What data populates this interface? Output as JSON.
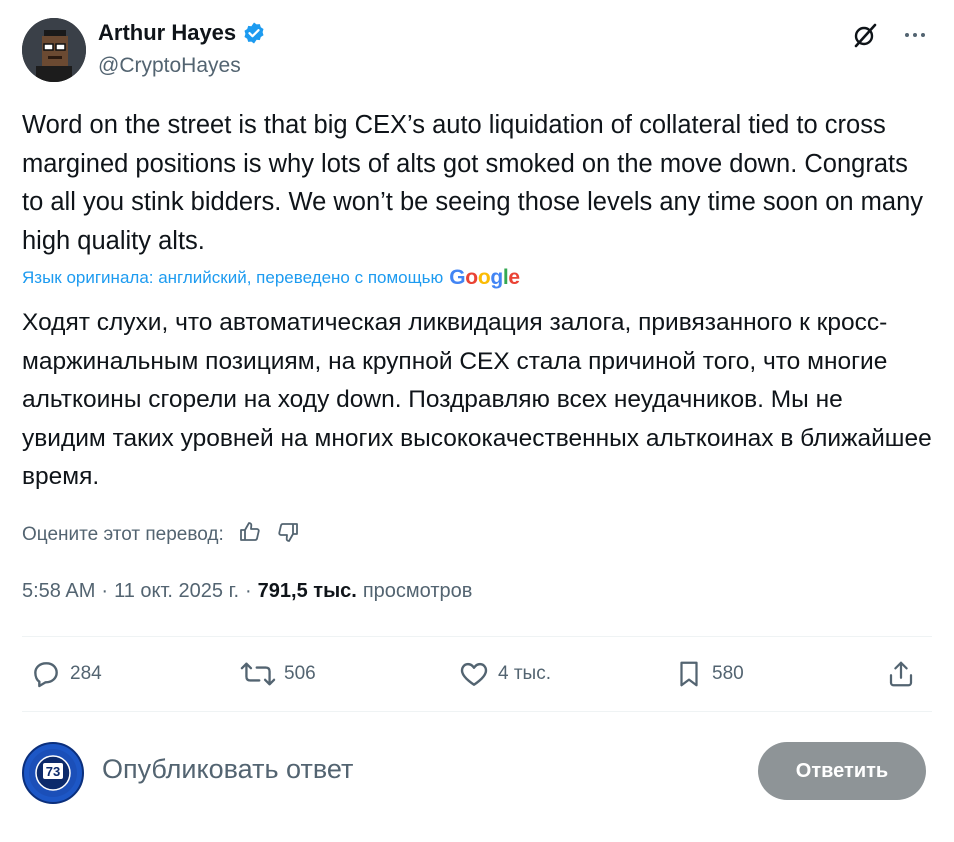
{
  "author": {
    "name": "Arthur Hayes",
    "handle": "@CryptoHayes"
  },
  "tweet": {
    "text": "Word on the street is that big CEX’s auto liquidation of collateral tied to cross margined positions is why lots of alts got smoked on the move down. Congrats to all you stink bidders. We won’t be seeing those levels any time soon on many high quality alts.",
    "translation_label": "Язык оригинала: английский, переведено с помощью",
    "google_brand": "Google",
    "translation": "Ходят слухи, что автоматическая ликвидация залога, привязанного к кросс-маржинальным позициям, на крупной CEX стала причиной того, что многие альткоины сгорели на ходу down. Поздравляю всех неудачников. Мы не увидим таких уровней на многих высококачественных альткоинах в ближайшее время.",
    "rate_label": "Оцените этот перевод:",
    "time": "5:58 AM",
    "date": "11 окт. 2025 г.",
    "views_count": "791,5 тыс.",
    "views_label": "просмотров"
  },
  "actions": {
    "replies": "284",
    "reposts": "506",
    "likes": "4 тыс.",
    "bookmarks": "580"
  },
  "reply": {
    "placeholder": "Опубликовать ответ",
    "button_label": "Ответить",
    "avatar_text": "73"
  },
  "colors": {
    "accent": "#1d9bf0",
    "muted": "#536471",
    "text": "#0f1419",
    "button_disabled": "#8e9497"
  }
}
